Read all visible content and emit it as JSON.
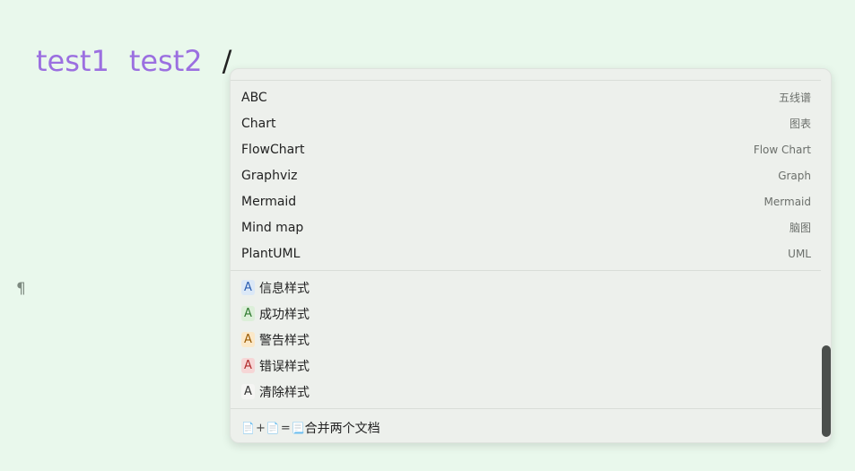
{
  "editor": {
    "tags": [
      "test1",
      "test2"
    ],
    "slash": "/",
    "pilcrow": "¶"
  },
  "menu": {
    "diagram_items": [
      {
        "label": "ABC",
        "hint": "五线谱"
      },
      {
        "label": "Chart",
        "hint": "图表"
      },
      {
        "label": "FlowChart",
        "hint": "Flow Chart"
      },
      {
        "label": "Graphviz",
        "hint": "Graph"
      },
      {
        "label": "Mermaid",
        "hint": "Mermaid"
      },
      {
        "label": "Mind map",
        "hint": "脑图"
      },
      {
        "label": "PlantUML",
        "hint": "UML"
      }
    ],
    "style_items": [
      {
        "badge": "A",
        "label": "信息样式",
        "kind": "info"
      },
      {
        "badge": "A",
        "label": "成功样式",
        "kind": "success"
      },
      {
        "badge": "A",
        "label": "警告样式",
        "kind": "warning"
      },
      {
        "badge": "A",
        "label": "错误样式",
        "kind": "error"
      },
      {
        "badge": "A",
        "label": "清除样式",
        "kind": "clear"
      }
    ],
    "merge": {
      "doc_icon": "📄",
      "plus": "+",
      "equals": "=",
      "result_icon": "📃",
      "label": "合并两个文档"
    }
  },
  "colors": {
    "background": "#e9f8ec",
    "tag": "#9b6fe0",
    "menu_bg": "#edf0ec",
    "scrollbar": "#4b4f4c"
  }
}
